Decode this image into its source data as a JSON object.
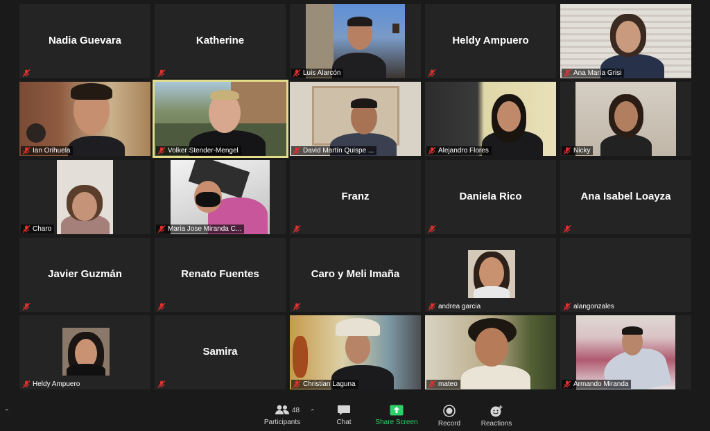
{
  "participants": [
    {
      "name": "Nadia Guevara",
      "video": false
    },
    {
      "name": "Katherine",
      "video": false
    },
    {
      "name": "Luis Alarcón",
      "video": true
    },
    {
      "name": "Heldy Ampuero",
      "video": false
    },
    {
      "name": "Ana María Grisi",
      "video": true
    },
    {
      "name": "Ian Orihuela",
      "video": true
    },
    {
      "name": "Volker Stender-Mengel",
      "video": true,
      "active_speaker": true
    },
    {
      "name": "David Martín Quispe ...",
      "video": true
    },
    {
      "name": "Alejandro Flores",
      "video": true
    },
    {
      "name": "Nicky",
      "video": true
    },
    {
      "name": "Charo",
      "video": true
    },
    {
      "name": "Maria Jose Miranda C...",
      "video": true
    },
    {
      "name": "Franz",
      "video": false
    },
    {
      "name": "Daniela Rico",
      "video": false
    },
    {
      "name": "Ana Isabel Loayza",
      "video": false
    },
    {
      "name": "Javier Guzmán",
      "video": false
    },
    {
      "name": "Renato Fuentes",
      "video": false
    },
    {
      "name": "Caro y Meli Imaña",
      "video": false
    },
    {
      "name": "andrea garcia",
      "video": true
    },
    {
      "name": "alangonzales",
      "video": false
    },
    {
      "name": "Heldy Ampuero",
      "video": true
    },
    {
      "name": "Samira",
      "video": false
    },
    {
      "name": "Christian Laguna",
      "video": true
    },
    {
      "name": "mateo",
      "video": true
    },
    {
      "name": "Armando Miranda",
      "video": true
    }
  ],
  "toolbar": {
    "participants_label": "Participants",
    "participants_count": "48",
    "chat_label": "Chat",
    "share_label": "Share Screen",
    "record_label": "Record",
    "reactions_label": "Reactions"
  },
  "colors": {
    "tile_bg": "#242424",
    "active_border": "#e3dd8a",
    "muted_red": "#e0312f",
    "share_green": "#2fcf6a"
  },
  "icons": {
    "muted": "microphone-muted-icon",
    "participants": "people-icon",
    "chat": "chat-bubble-icon",
    "share": "share-screen-icon",
    "record": "record-icon",
    "reactions": "reactions-icon"
  }
}
